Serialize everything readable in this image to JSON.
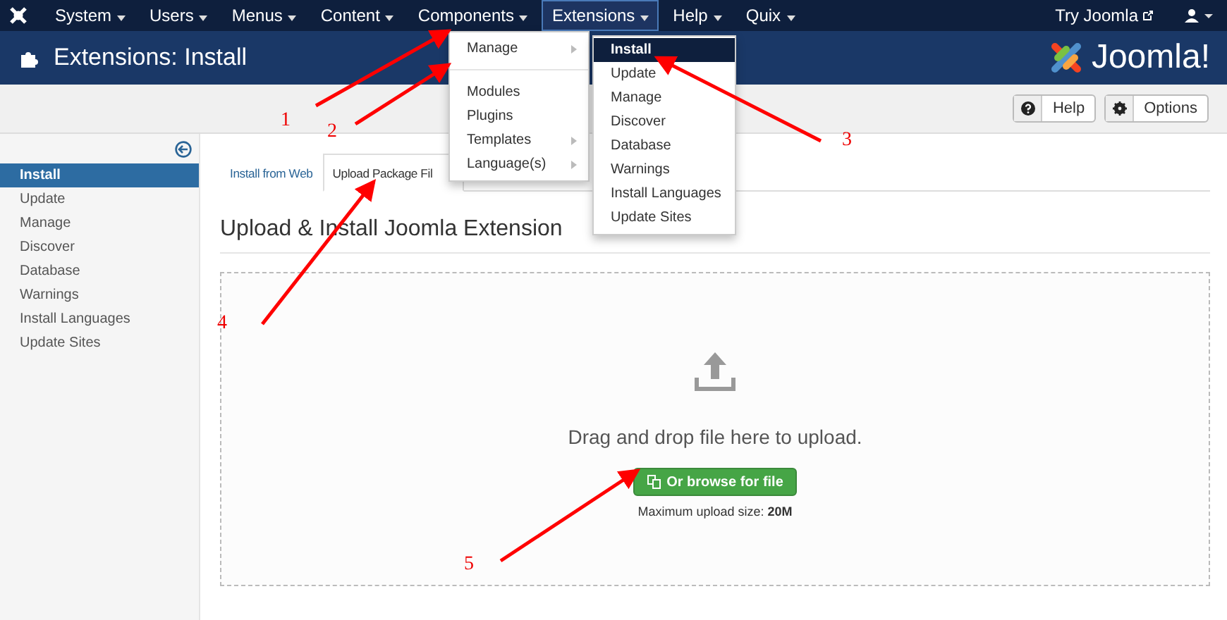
{
  "topbar": {
    "menus": [
      {
        "label": "System",
        "selected": false
      },
      {
        "label": "Users",
        "selected": false
      },
      {
        "label": "Menus",
        "selected": false
      },
      {
        "label": "Content",
        "selected": false
      },
      {
        "label": "Components",
        "selected": false
      },
      {
        "label": "Extensions",
        "selected": true
      },
      {
        "label": "Help",
        "selected": false
      },
      {
        "label": "Quix",
        "selected": false
      }
    ],
    "try_link": "Try Joomla"
  },
  "header": {
    "title": "Extensions: Install",
    "logo": "Joomla!"
  },
  "toolbar": {
    "buttons": [
      {
        "label": "Help",
        "kind": "help"
      },
      {
        "label": "Options",
        "kind": "options"
      }
    ]
  },
  "sidebar": {
    "items": [
      {
        "label": "Install",
        "selected": true
      },
      {
        "label": "Update",
        "selected": false
      },
      {
        "label": "Manage",
        "selected": false
      },
      {
        "label": "Discover",
        "selected": false
      },
      {
        "label": "Database",
        "selected": false
      },
      {
        "label": "Warnings",
        "selected": false
      },
      {
        "label": "Install Languages",
        "selected": false
      },
      {
        "label": "Update Sites",
        "selected": false
      }
    ]
  },
  "tabs": [
    {
      "label": "Install from Web",
      "selected": false
    },
    {
      "label": "Upload Package Fil",
      "selected": true
    }
  ],
  "section_title": "Upload & Install Joomla Extension",
  "dropzone": {
    "message": "Drag and drop file here to upload.",
    "button": "Or browse for file",
    "max_size": "Maximum upload size: **20M**"
  },
  "extensions_menu": {
    "groups": [
      [
        {
          "label": "Manage",
          "has_submenu": true
        }
      ],
      [
        {
          "label": "Modules",
          "has_submenu": false
        },
        {
          "label": "Plugins",
          "has_submenu": false
        },
        {
          "label": "Templates",
          "has_submenu": true
        },
        {
          "label": "Language(s)",
          "has_submenu": true
        }
      ]
    ]
  },
  "manage_submenu": {
    "items": [
      {
        "label": "Install",
        "selected": true
      },
      {
        "label": "Update",
        "selected": false
      },
      {
        "label": "Manage",
        "selected": false
      },
      {
        "label": "Discover",
        "selected": false
      },
      {
        "label": "Database",
        "selected": false
      },
      {
        "label": "Warnings",
        "selected": false
      },
      {
        "label": "Install Languages",
        "selected": false
      },
      {
        "label": "Update Sites",
        "selected": false
      }
    ]
  },
  "annotations": [
    {
      "label": "1"
    },
    {
      "label": "2"
    },
    {
      "label": "3"
    },
    {
      "label": "4"
    },
    {
      "label": "5"
    }
  ]
}
